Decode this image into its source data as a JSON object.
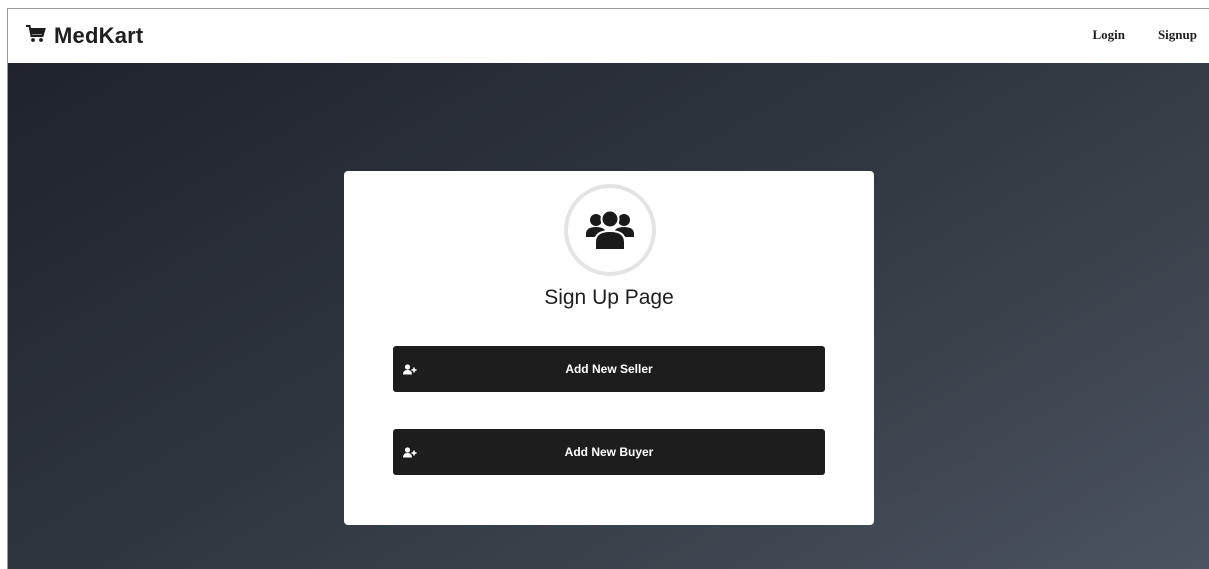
{
  "navbar": {
    "brand": "MedKart",
    "brand_icon": "shopping-cart-icon",
    "links": [
      {
        "label": "Login"
      },
      {
        "label": "Signup"
      }
    ]
  },
  "signup_card": {
    "icon": "users-icon",
    "title": "Sign Up Page",
    "buttons": [
      {
        "label": "Add New Seller",
        "icon": "user-plus-icon"
      },
      {
        "label": "Add New Buyer",
        "icon": "user-plus-icon"
      }
    ]
  },
  "colors": {
    "button_bg": "#1d1d1d",
    "hero_gradient_start": "#1f232a",
    "hero_gradient_end": "#4a5461"
  }
}
